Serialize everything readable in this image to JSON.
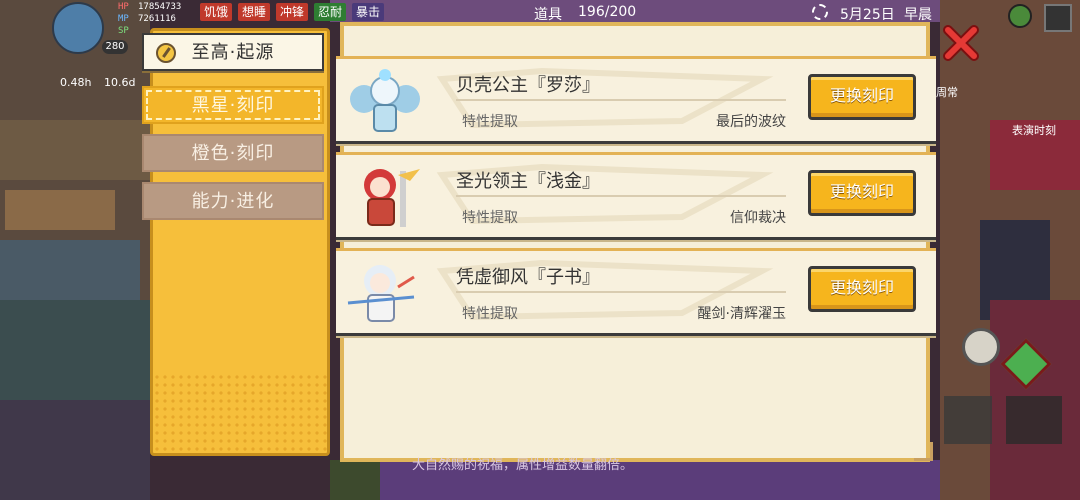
{
  "hud": {
    "hp_label": "HP",
    "hp_value": "17854733",
    "mp_label": "MP",
    "mp_value": "7261116",
    "sp_label": "SP",
    "level": "280",
    "timer_1": "0.48h",
    "timer_2": "10.6d",
    "status_tags": [
      "饥饿",
      "想睡",
      "冲锋",
      "忍耐",
      "暴击"
    ],
    "items_label": "道具",
    "items_count": "196/200",
    "date": "5月25日",
    "time_of_day": "早晨",
    "side_label_1": "周常",
    "side_label_2": "表演时刻"
  },
  "sidebar": {
    "tabs": [
      {
        "label": "至高·起源",
        "state": "active"
      },
      {
        "label": "黑星·刻印",
        "state": "selected"
      },
      {
        "label": "橙色·刻印",
        "state": "inactive"
      },
      {
        "label": "能力·进化",
        "state": "inactive"
      }
    ]
  },
  "cards": [
    {
      "name": "贝壳公主『罗莎』",
      "trait_label": "特性提取",
      "trait_value": "最后的波纹",
      "button": "更换刻印",
      "portrait": "shell-princess-portrait"
    },
    {
      "name": "圣光领主『浅金』",
      "trait_label": "特性提取",
      "trait_value": "信仰裁决",
      "button": "更换刻印",
      "portrait": "holy-lord-portrait"
    },
    {
      "name": "凭虚御风『子书』",
      "trait_label": "特性提取",
      "trait_value": "醒剑·清辉濯玉",
      "button": "更换刻印",
      "portrait": "wind-swordswoman-portrait"
    }
  ],
  "footer_text": "大自然赐的祝福，属性增益数量翻倍。",
  "colors": {
    "accent": "#f6b51d",
    "panel": "#f6efd9",
    "sidebar": "#f6bf3b",
    "close": "#e53935"
  }
}
